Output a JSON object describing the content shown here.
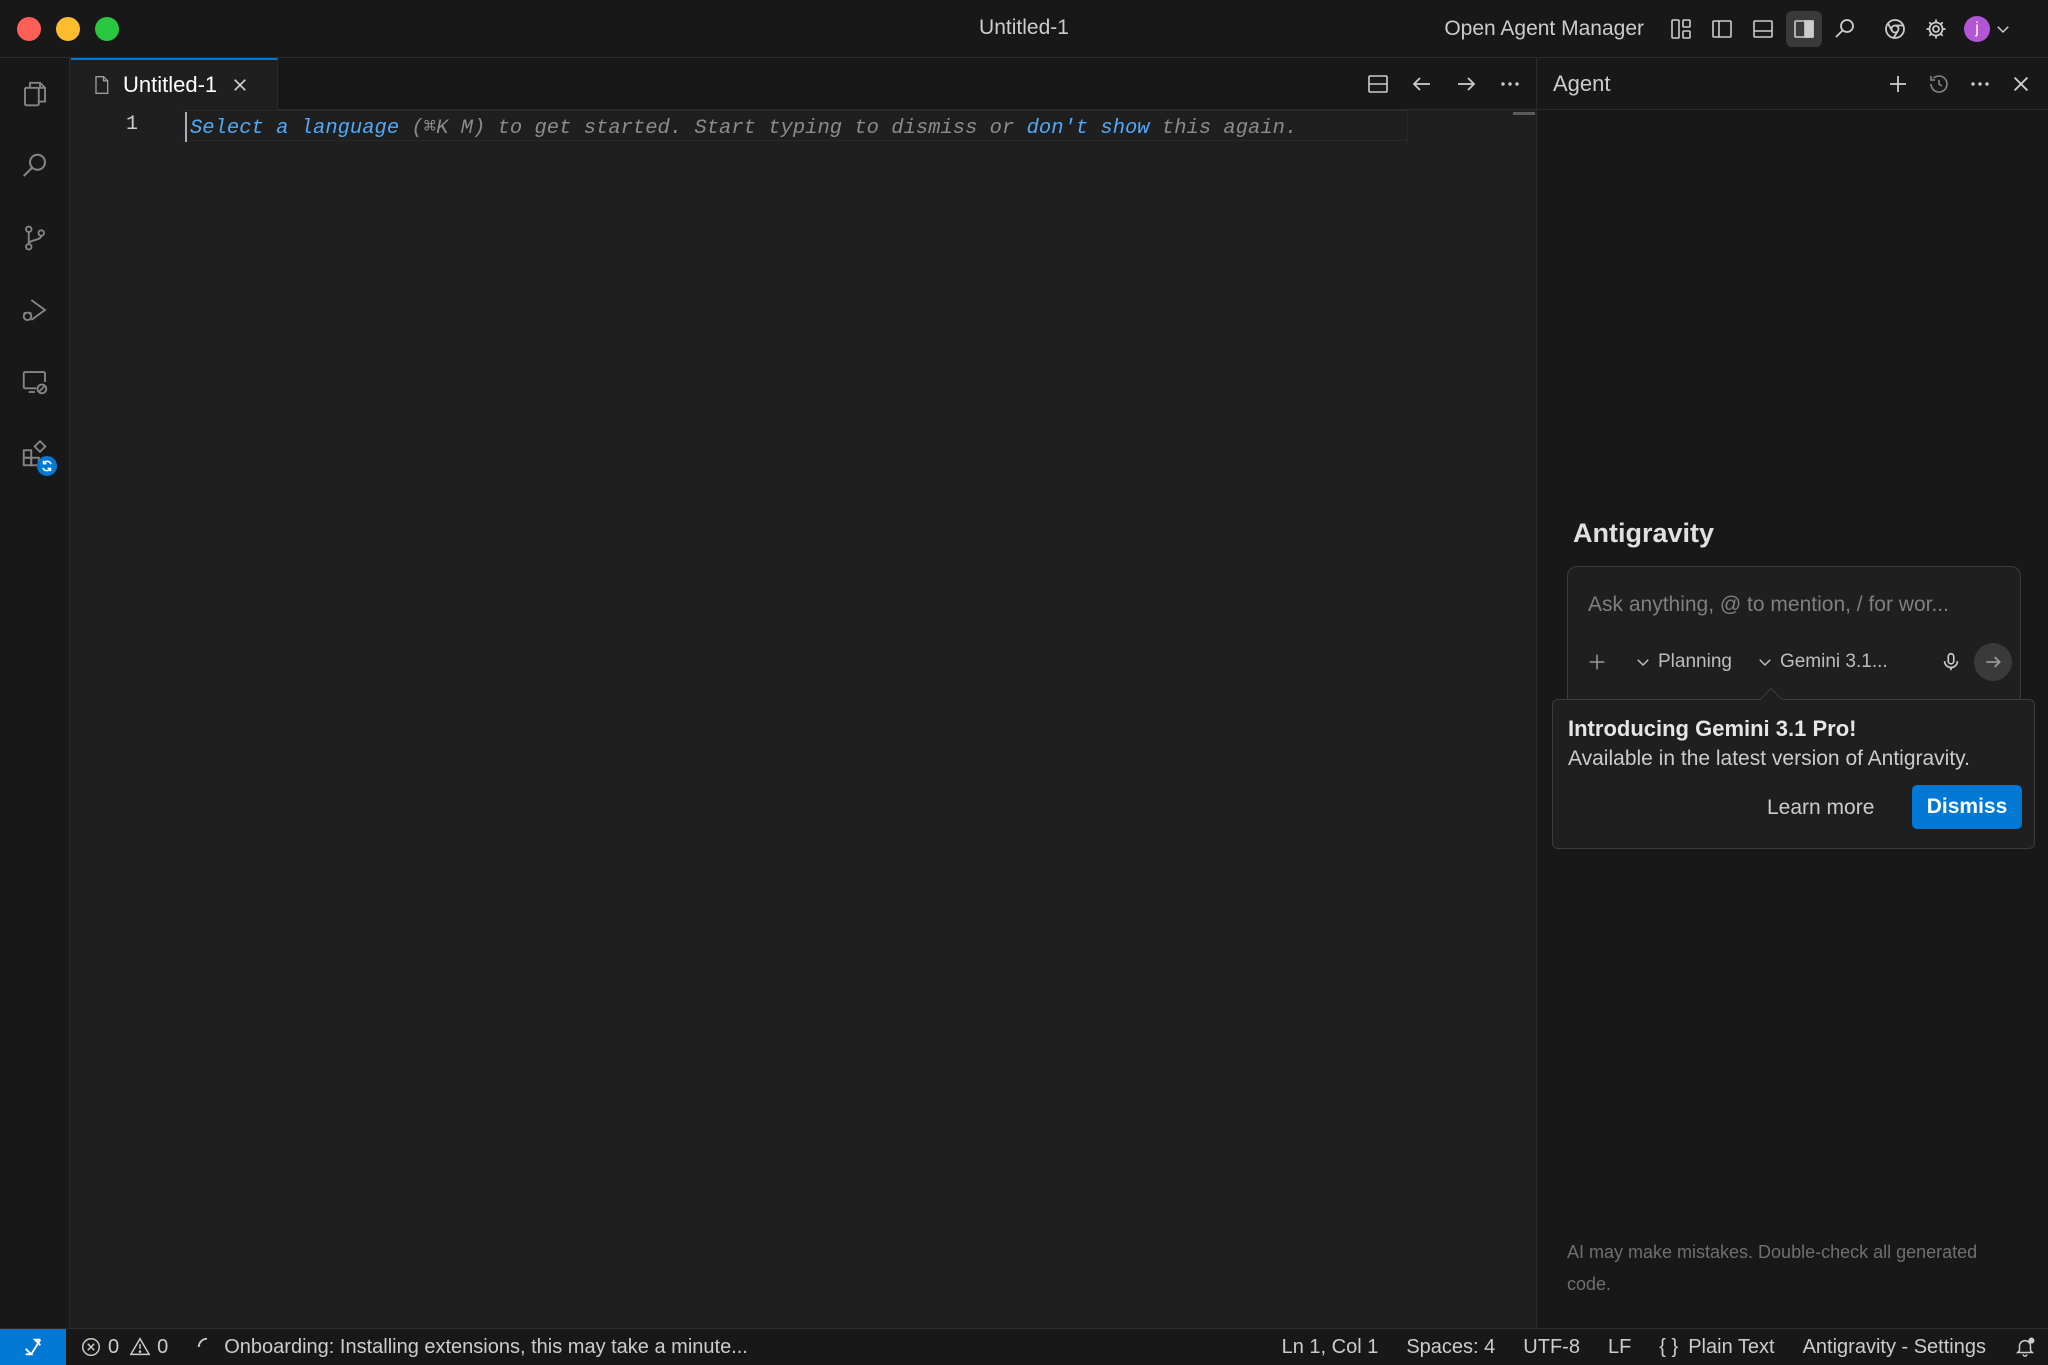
{
  "window": {
    "title": "Untitled-1",
    "open_agent_manager": "Open Agent Manager",
    "avatar_initial": "j"
  },
  "activity_bar": {
    "items": [
      {
        "name": "explorer-icon"
      },
      {
        "name": "search-icon"
      },
      {
        "name": "source-control-icon"
      },
      {
        "name": "run-debug-icon"
      },
      {
        "name": "remote-explorer-icon"
      },
      {
        "name": "extensions-icon",
        "badge": "updating"
      }
    ]
  },
  "editor": {
    "tab_label": "Untitled-1",
    "line_number": "1",
    "hint": {
      "select_language": "Select a language",
      "middle": " (⌘K M) to get started. Start typing to dismiss or ",
      "dont_show": "don't show",
      "end": " this again."
    }
  },
  "agent_panel": {
    "header_title": "Agent",
    "brand_title": "Antigravity",
    "input_placeholder": "Ask anything, @ to mention, / for wor...",
    "mode_label": "Planning",
    "model_label": "Gemini 3.1...",
    "popup": {
      "title": "Introducing Gemini 3.1 Pro!",
      "body": "Available in the latest version of Antigravity.",
      "learn_more": "Learn more",
      "dismiss": "Dismiss"
    },
    "disclaimer": "AI may make mistakes. Double-check all generated code."
  },
  "status_bar": {
    "errors": "0",
    "warnings": "0",
    "progress_message": "Onboarding: Installing extensions, this may take a minute...",
    "cursor_position": "Ln 1, Col 1",
    "indentation": "Spaces: 4",
    "encoding": "UTF-8",
    "eol": "LF",
    "language_mode": "Plain Text",
    "settings": "Antigravity - Settings"
  },
  "colors": {
    "accent": "#0078d4",
    "link": "#4daafc",
    "background": "#1f1f1f",
    "chrome": "#181818"
  }
}
